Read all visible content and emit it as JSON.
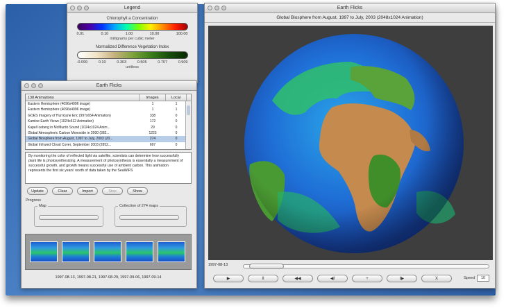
{
  "legend": {
    "window_title": "Legend",
    "chlorophyll_title": "Chlorophyll a Concentration",
    "chlorophyll_ticks": [
      "0.01",
      "0.10",
      "1.00",
      "10.00",
      "100.00"
    ],
    "chlorophyll_unit": "milligrams per cubic meter",
    "ndvi_title": "Normalized Difference Vegetation Index",
    "ndvi_ticks": [
      "-0.099",
      "0.10",
      "0.303",
      "0.505",
      "0.707",
      "0.909"
    ],
    "ndvi_unit": "unitless"
  },
  "list_window": {
    "title": "Earth Flicks",
    "table_header": {
      "name": "138 Animations",
      "images": "Images",
      "local": "Local"
    },
    "rows": [
      {
        "name": "Eastern Hemisphere (4096x4096 image)",
        "images": "1",
        "local": "1"
      },
      {
        "name": "Eastern Hemisphere (4096x4096 image)",
        "images": "1",
        "local": "1"
      },
      {
        "name": "GOES Imagery of Hurricane Eric (997x654 Animation)",
        "images": "338",
        "local": "0"
      },
      {
        "name": "Kamloe Earth Views (1024x512 Animation)",
        "images": "172",
        "local": "0"
      },
      {
        "name": "Kapel Iceberg in McMurdo Sound (1024x1024 Anim...",
        "images": "29",
        "local": "0"
      },
      {
        "name": "Global Atmospheric Carbon Monoxide in 2000 (382...",
        "images": "1223",
        "local": "0"
      },
      {
        "name": "Global Biosphere from August, 1997 to July, 2003 (20...",
        "images": "274",
        "local": "0"
      },
      {
        "name": "Global Infrared Cloud Cover, September 2003 (2852...",
        "images": "697",
        "local": "0"
      }
    ],
    "selected_index": 6,
    "description": "By monitoring the color of reflected light via satellite, scientists can determine how successfully plant life is photosynthesizing. A measurement of photosynthesis is essentially a measurement of successful growth, and growth means successful use of ambient carbon. This animation represents the first six years' worth of data taken by the SeaWiFS",
    "buttons": {
      "update": "Update",
      "clear": "Clear",
      "import": "Import",
      "stop": "Stop",
      "show": "Show"
    },
    "progress_label": "Progress",
    "map_label": "Map",
    "collection_label": "Collection of 274 maps",
    "dates": "1997-08-13, 1997-08-21, 1997-08-29, 1997-09-06, 1997-09-14"
  },
  "viewer": {
    "window_title": "Earth Flicks",
    "heading": "Global Biosphere from August, 1997 to July, 2003 (2048x1024 Animation)",
    "current_date": "1997-08-13",
    "speed_label": "Speed",
    "speed_value": "10"
  },
  "transport": {
    "play": "▶",
    "pause": "II",
    "back": "◀◀",
    "rev": "◀",
    "step_back": "◀I",
    "add": "+",
    "step_fwd": "I▶",
    "close": "X"
  }
}
